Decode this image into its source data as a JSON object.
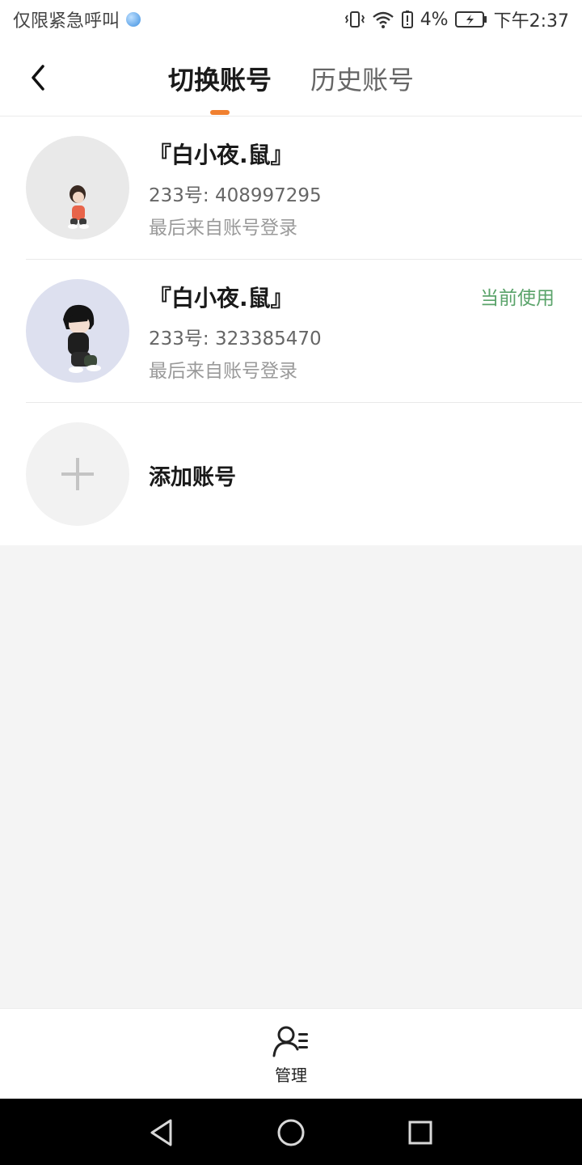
{
  "status_bar": {
    "carrier": "仅限紧急呼叫",
    "battery": "4%",
    "time": "下午2:37"
  },
  "header": {
    "tabs": [
      "切换账号",
      "历史账号"
    ],
    "active_tab": "切换账号"
  },
  "accounts": [
    {
      "name": "『白小夜.鼠』",
      "id": "233号: 408997295",
      "login_note": "最后来自账号登录",
      "current": ""
    },
    {
      "name": "『白小夜.鼠』",
      "id": "233号: 323385470",
      "login_note": "最后来自账号登录",
      "current": "当前使用"
    }
  ],
  "add_account": {
    "label": "添加账号"
  },
  "bottom_bar": {
    "manage_label": "管理"
  },
  "colors": {
    "accent": "#f08030",
    "current": "#5aa36a",
    "background": "#f4f4f4"
  },
  "icons": [
    "back-icon",
    "plus-icon",
    "manage-icon",
    "nav-back-icon",
    "nav-home-icon",
    "nav-recents-icon"
  ]
}
